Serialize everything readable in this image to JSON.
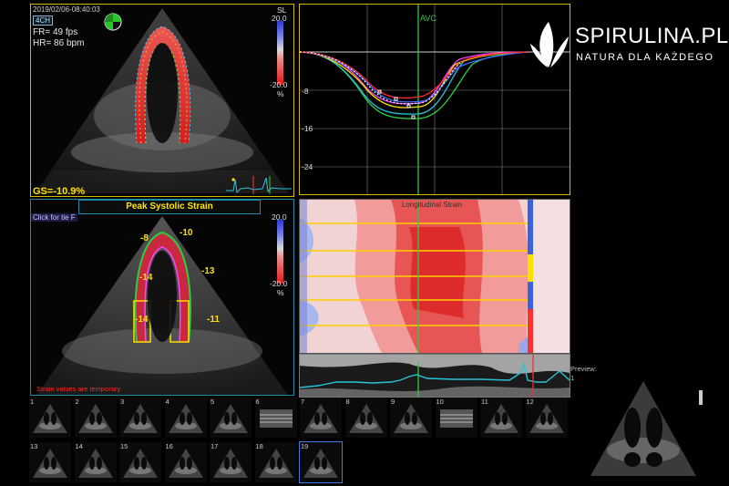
{
  "top_panel": {
    "timestamp": "2019/02/06-08:40:03",
    "view_badge": "4CH",
    "frame_rate": "FR= 49 fps",
    "heart_rate": "HR= 86 bpm",
    "gs": "GS=-10.9%",
    "sl_label": "SL",
    "scale_top": "20.0",
    "scale_bottom": "-20.0",
    "scale_unit": "%"
  },
  "bottom_panel": {
    "title": "Peak Systolic Strain",
    "click_tip": "Click for tie F",
    "warning": "Strain values are temporary",
    "scale_top": "20.0",
    "scale_bottom": "-20.0",
    "scale_unit": "%",
    "segments": [
      "-8",
      "-10",
      "-14",
      "-13",
      "-14",
      "-11"
    ]
  },
  "curves": {
    "event_label": "AVC",
    "y_ticks": [
      "-8",
      "-16",
      "-24"
    ]
  },
  "heatmap": {
    "title": "Longitudinal Strain"
  },
  "thumbnails": {
    "row1": [
      "1",
      "2",
      "3",
      "4",
      "5",
      "6",
      "7",
      "8",
      "9",
      "10",
      "11",
      "12"
    ],
    "row2": [
      "13",
      "14",
      "15",
      "16",
      "17",
      "18",
      "19"
    ]
  },
  "preview": {
    "label": "Preview:",
    "index": "1"
  },
  "brand": {
    "name": "SPIRULINA.PL",
    "tagline": "NATURA DLA KAŻDEGO"
  },
  "colors": {
    "panel_border": "#d4b800",
    "avc_line": "#2ecc40",
    "strain_red": "#e01818",
    "strain_blue": "#2a3bd6"
  }
}
